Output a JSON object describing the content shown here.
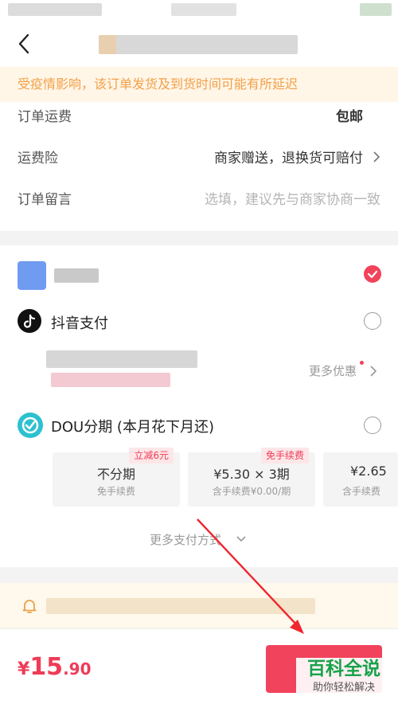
{
  "notice": {
    "text": "受疫情影响，该订单发货及到货时间可能有所延迟"
  },
  "order": {
    "shipping_label": "订单运费",
    "shipping_value": "包邮",
    "insurance_label": "运费险",
    "insurance_value": "商家赠送，退换货可赔付",
    "message_label": "订单留言",
    "message_placeholder": "选填，建议先与商家协商一致"
  },
  "payment": {
    "option1_checked": true,
    "douyin_pay": "抖音支付",
    "more_discounts": "更多优惠",
    "dou_installment": "DOU分期 (本月花下月还)",
    "plans": [
      {
        "badge": "立减6元",
        "title": "不分期",
        "sub": "免手续费"
      },
      {
        "badge": "免手续费",
        "title": "¥5.30 × 3期",
        "sub": "含手续费¥0.00/期"
      },
      {
        "badge": "",
        "title": "¥2.65",
        "sub": "含手续费"
      }
    ],
    "more_methods": "更多支付方式"
  },
  "bottom": {
    "price_symbol": "¥",
    "price_int": "15",
    "price_dec": ".90",
    "watermark_main": "百科全说",
    "watermark_sub": "助你轻松解决"
  },
  "colors": {
    "accent": "#f1435b",
    "notice_text": "#f2a048",
    "notice_bg": "#fff6e8",
    "badge_bg": "#fde6e8"
  },
  "icons": [
    "back-arrow-icon",
    "douyin-logo-icon",
    "dou-installment-icon",
    "bell-icon",
    "chevron-right-icon",
    "chevron-down-icon",
    "checkmark-icon"
  ]
}
